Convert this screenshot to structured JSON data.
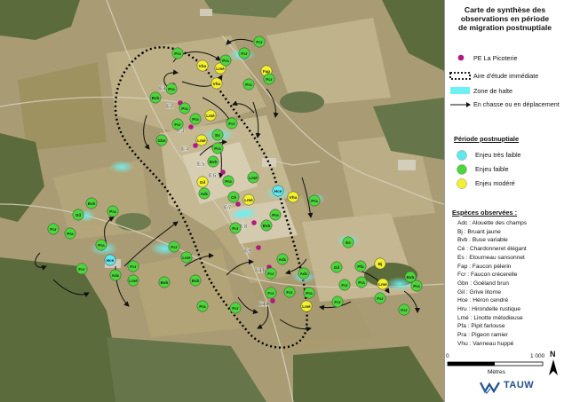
{
  "legend": {
    "title_lines": [
      "Carte de synthèse des",
      "observations en période",
      "de migration postnuptiale"
    ],
    "items": [
      {
        "label": "PE La Picoterie"
      },
      {
        "label": "Aire d'étude immédiate"
      },
      {
        "label": "Zone de halte"
      },
      {
        "label": "En chasse ou en déplacement"
      }
    ],
    "period_heading": "Période postnuptiale",
    "enjeux": [
      {
        "label": "Enjeu très faible",
        "color": "#5ee8f0"
      },
      {
        "label": "Enjeu faible",
        "color": "#4cd63a"
      },
      {
        "label": "Enjeu modéré",
        "color": "#f4f12c"
      }
    ],
    "species_heading": "Espèces observées :",
    "species": [
      "Adc : Alouette des champs",
      "Bj : Bruant jaune",
      "Bvb : Buse variable",
      "Cé : Chardonneret élégant",
      "Es : Etourneau sansonnet",
      "Fap : Faucon pèlerin",
      "Fcr : Faucon crécerelle",
      "Gbn : Goéland brun",
      "Gil : Grive litorne",
      "Hce : Héron cendré",
      "Hru : Hirondelle rustique",
      "Lmé : Linotte mélodieuse",
      "Pfa : Pipit farlouse",
      "Pra : Pigeon ramier",
      "Vhu : Vanneau huppé"
    ]
  },
  "scale": {
    "start": "0",
    "end": "1 000",
    "unit": "Mètres"
  },
  "north": "N",
  "logo": "TAUW",
  "turbines": [
    {
      "id": "E1"
    },
    {
      "id": "E2"
    },
    {
      "id": "E3"
    },
    {
      "id": "E4"
    },
    {
      "id": "E5"
    },
    {
      "id": "E6"
    },
    {
      "id": "E7"
    },
    {
      "id": "E8"
    },
    {
      "id": "E9"
    },
    {
      "id": "E10"
    },
    {
      "id": "E11"
    }
  ],
  "observations": [
    {
      "code": "Fcr",
      "enjeu": "faible"
    },
    {
      "code": "Fcr",
      "enjeu": "faible"
    },
    {
      "code": "Pra",
      "enjeu": "faible"
    },
    {
      "code": "Vhu",
      "enjeu": "modere"
    },
    {
      "code": "Vhu",
      "enjeu": "modere"
    },
    {
      "code": "Lmé",
      "enjeu": "modere"
    },
    {
      "code": "Pra",
      "enjeu": "faible"
    },
    {
      "code": "Fap",
      "enjeu": "modere"
    },
    {
      "code": "Fcr",
      "enjeu": "faible"
    },
    {
      "code": "Pra",
      "enjeu": "faible"
    },
    {
      "code": "Bvb",
      "enjeu": "faible"
    },
    {
      "code": "Pra",
      "enjeu": "faible"
    },
    {
      "code": "Pra",
      "enjeu": "faible"
    },
    {
      "code": "Pra",
      "enjeu": "faible"
    },
    {
      "code": "Gbn",
      "enjeu": "faible"
    },
    {
      "code": "Es",
      "enjeu": "faible"
    },
    {
      "code": "Fcr",
      "enjeu": "faible"
    },
    {
      "code": "Lmé",
      "enjeu": "modere"
    },
    {
      "code": "Fcr",
      "enjeu": "faible"
    },
    {
      "code": "Lmé",
      "enjeu": "modere"
    },
    {
      "code": "Pra",
      "enjeu": "faible"
    },
    {
      "code": "Gil",
      "enjeu": "modere"
    },
    {
      "code": "Adc",
      "enjeu": "faible"
    },
    {
      "code": "Pra",
      "enjeu": "faible"
    },
    {
      "code": "Bvb",
      "enjeu": "faible"
    },
    {
      "code": "Cé",
      "enjeu": "faible"
    },
    {
      "code": "Lmé",
      "enjeu": "modere"
    },
    {
      "code": "Hce",
      "enjeu": "tres_faible"
    },
    {
      "code": "Vhu",
      "enjeu": "modere"
    },
    {
      "code": "Pra",
      "enjeu": "faible"
    },
    {
      "code": "Lmé",
      "enjeu": "faible"
    },
    {
      "code": "Pra",
      "enjeu": "faible"
    },
    {
      "code": "Bvb",
      "enjeu": "faible"
    },
    {
      "code": "Fcr",
      "enjeu": "faible"
    },
    {
      "code": "Gil",
      "enjeu": "faible"
    },
    {
      "code": "Bvb",
      "enjeu": "faible"
    },
    {
      "code": "Pra",
      "enjeu": "faible"
    },
    {
      "code": "Fcr",
      "enjeu": "faible"
    },
    {
      "code": "Pra",
      "enjeu": "faible"
    },
    {
      "code": "Hce",
      "enjeu": "tres_faible"
    },
    {
      "code": "Adc",
      "enjeu": "faible"
    },
    {
      "code": "Fcr",
      "enjeu": "faible"
    },
    {
      "code": "Pra",
      "enjeu": "faible"
    },
    {
      "code": "Fcr",
      "enjeu": "faible"
    },
    {
      "code": "Lmé",
      "enjeu": "faible"
    },
    {
      "code": "Bvb",
      "enjeu": "faible"
    },
    {
      "code": "Fcr",
      "enjeu": "faible"
    },
    {
      "code": "Lmé",
      "enjeu": "faible"
    },
    {
      "code": "Bvb",
      "enjeu": "faible"
    },
    {
      "code": "Pra",
      "enjeu": "faible"
    },
    {
      "code": "Fcr",
      "enjeu": "faible"
    },
    {
      "code": "Adc",
      "enjeu": "faible"
    },
    {
      "code": "Fcr",
      "enjeu": "faible"
    },
    {
      "code": "Fcr",
      "enjeu": "faible"
    },
    {
      "code": "Adc",
      "enjeu": "faible"
    },
    {
      "code": "Pra",
      "enjeu": "faible"
    },
    {
      "code": "Gil",
      "enjeu": "faible"
    },
    {
      "code": "Fcr",
      "enjeu": "faible"
    },
    {
      "code": "Fcr",
      "enjeu": "faible"
    },
    {
      "code": "Pra",
      "enjeu": "faible"
    },
    {
      "code": "Es",
      "enjeu": "faible"
    },
    {
      "code": "Bj",
      "enjeu": "modere"
    },
    {
      "code": "Lmé",
      "enjeu": "modere"
    },
    {
      "code": "Fcr",
      "enjeu": "faible"
    },
    {
      "code": "Pfa",
      "enjeu": "faible"
    },
    {
      "code": "Bvb",
      "enjeu": "faible"
    },
    {
      "code": "Fcr",
      "enjeu": "faible"
    },
    {
      "code": "Pra",
      "enjeu": "faible"
    },
    {
      "code": "Lmé",
      "enjeu": "modere"
    },
    {
      "code": "Fcr",
      "enjeu": "faible"
    }
  ],
  "colors": {
    "tres_faible": "#5ee8f0",
    "faible": "#4cd63a",
    "modere": "#f4f12c",
    "turbine": "#b0197f",
    "halo": "#5fe6ea"
  }
}
